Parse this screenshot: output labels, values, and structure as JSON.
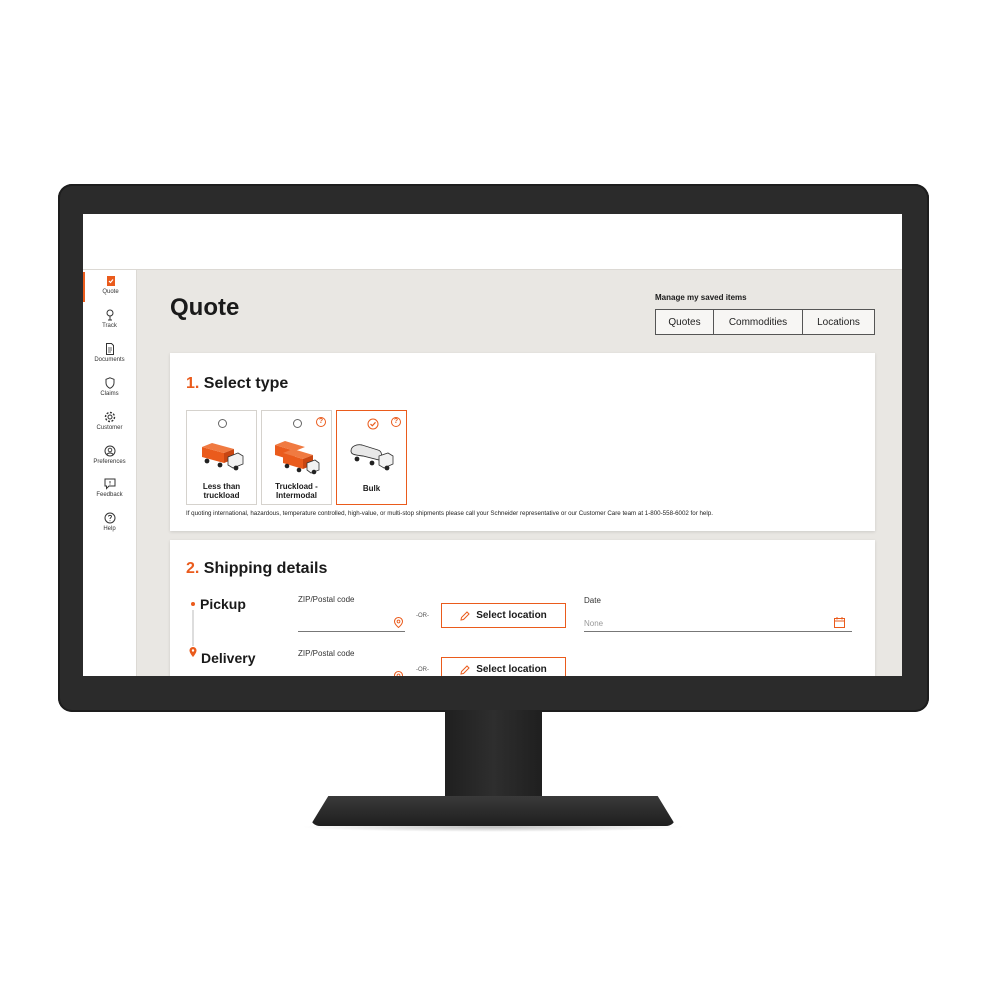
{
  "page": {
    "title": "Quote"
  },
  "sidebar": {
    "items": [
      {
        "label": "Quote",
        "icon": "quote-icon"
      },
      {
        "label": "Track",
        "icon": "track-icon"
      },
      {
        "label": "Documents",
        "icon": "documents-icon"
      },
      {
        "label": "Claims",
        "icon": "shield-icon"
      },
      {
        "label": "Customer",
        "icon": "gear-icon"
      },
      {
        "label": "Preferences",
        "icon": "user-icon"
      },
      {
        "label": "Feedback",
        "icon": "chat-icon"
      },
      {
        "label": "Help",
        "icon": "help-icon"
      }
    ]
  },
  "saved": {
    "label": "Manage my saved items",
    "buttons": [
      "Quotes",
      "Commodities",
      "Locations"
    ]
  },
  "select_type": {
    "number": "1.",
    "title": "Select type",
    "options": [
      {
        "label_line1": "Less than",
        "label_line2": "truckload",
        "selected": false,
        "has_help": false
      },
      {
        "label_line1": "Truckload -",
        "label_line2": "Intermodal",
        "selected": false,
        "has_help": true
      },
      {
        "label_line1": "Bulk",
        "label_line2": "",
        "selected": true,
        "has_help": true
      }
    ],
    "note": "If quoting international, hazardous, temperature controlled, high-value, or multi-stop shipments please call your Schneider representative or our Customer Care team at 1-800-558-6002 for help."
  },
  "shipping": {
    "number": "2.",
    "title": "Shipping details",
    "pickup": {
      "label": "Pickup",
      "zip_label": "ZIP/Postal code",
      "or": "-OR-",
      "button": "Select location",
      "date_label": "Date",
      "date_value": "None"
    },
    "delivery": {
      "label": "Delivery",
      "zip_label": "ZIP/Postal code",
      "or": "-OR-",
      "button": "Select location"
    }
  },
  "colors": {
    "accent": "#ea5b1c",
    "background": "#e9e7e3",
    "monitor": "#2b2b2b"
  },
  "help_glyph": "?"
}
